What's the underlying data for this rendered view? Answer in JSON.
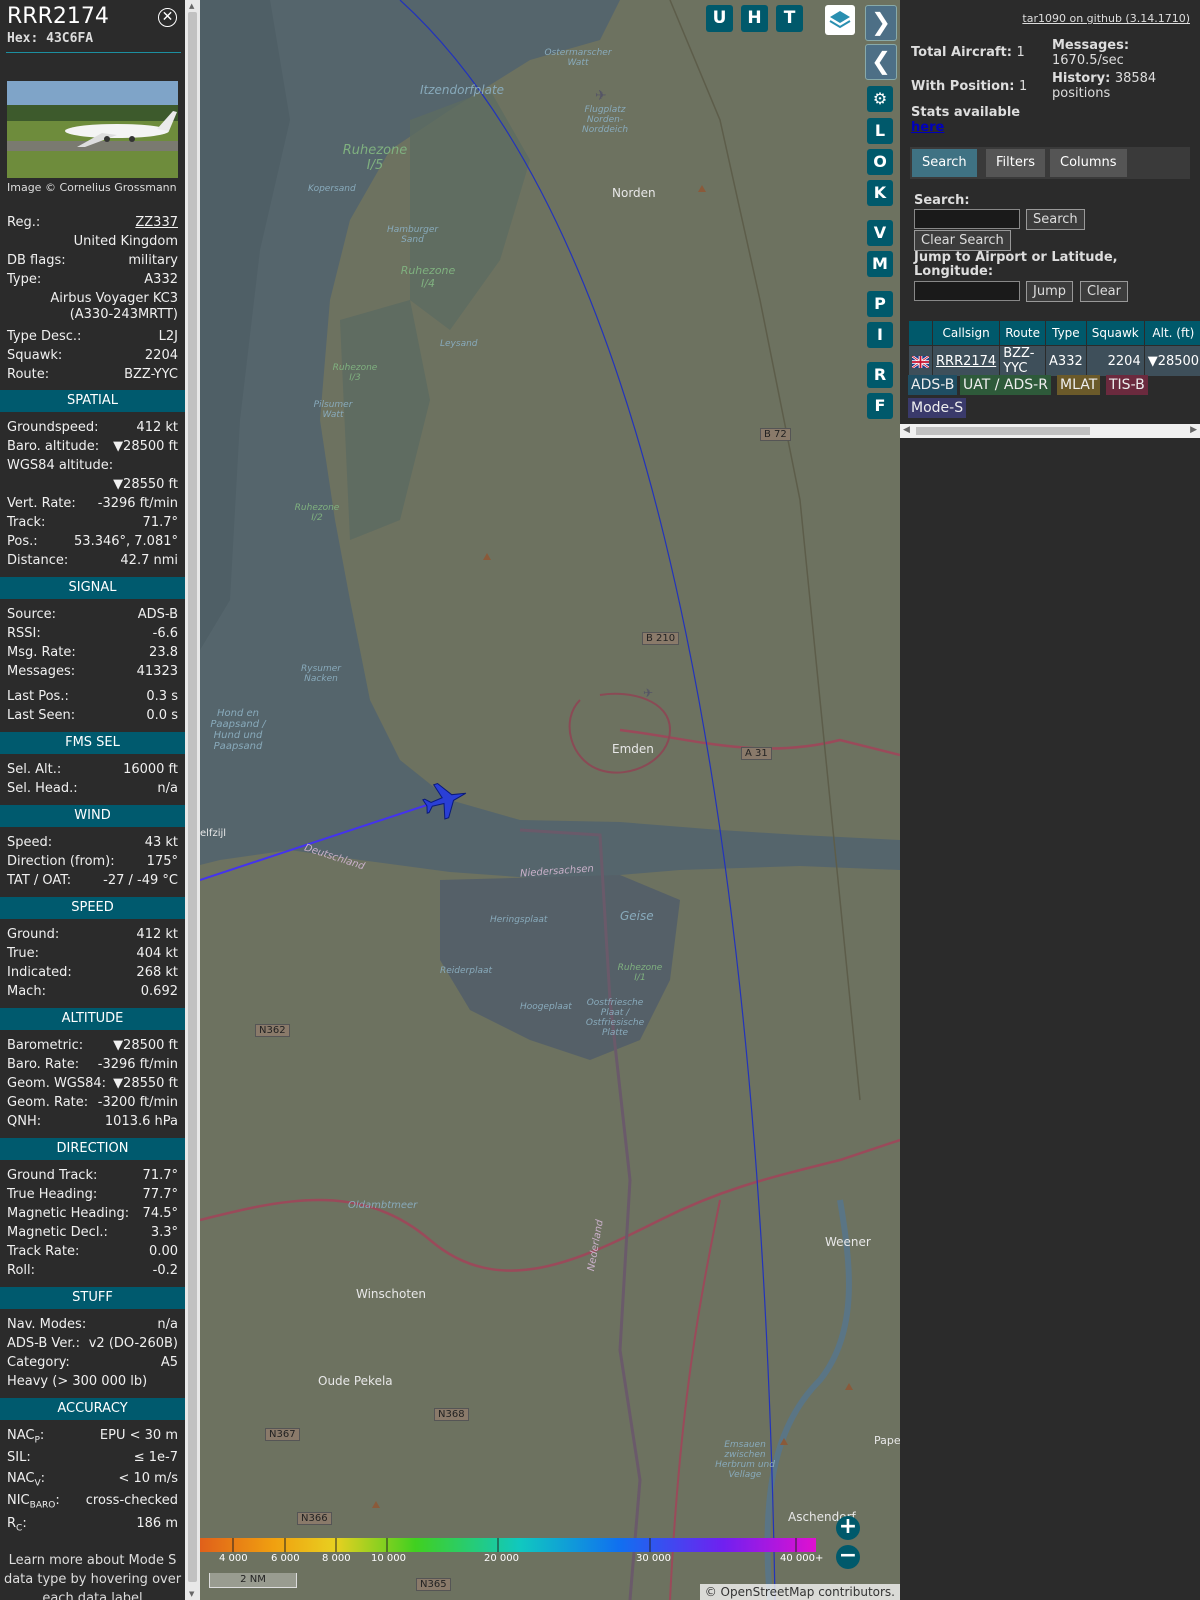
{
  "selected": {
    "callsign": "RRR2174",
    "hex": "Hex: 43C6FA",
    "image_credit": "Image © Cornelius Grossmann",
    "reg_label": "Reg.:",
    "reg_value": "ZZ337",
    "country": "United Kingdom",
    "dbflags_label": "DB flags:",
    "dbflags_value": "military",
    "type_label": "Type:",
    "type_value": "A332",
    "type_full": "Airbus Voyager KC3 (A330-243MRTT)",
    "typedesc_label": "Type Desc.:",
    "typedesc_value": "L2J",
    "squawk_label": "Squawk:",
    "squawk_value": "2204",
    "route_label": "Route:",
    "route_value": "BZZ-YYC"
  },
  "sections": {
    "spatial": "SPATIAL",
    "signal": "SIGNAL",
    "fms": "FMS SEL",
    "wind": "WIND",
    "speed": "SPEED",
    "altitude": "ALTITUDE",
    "direction": "DIRECTION",
    "stuff": "STUFF",
    "accuracy": "ACCURACY"
  },
  "spatial": {
    "gs_label": "Groundspeed:",
    "gs_value": "412 kt",
    "baro_label": "Baro. altitude:",
    "baro_value": "▼28500 ft",
    "wgs_label": "WGS84 altitude:",
    "wgs_value": "▼28550 ft",
    "vrate_label": "Vert. Rate:",
    "vrate_value": "-3296 ft/min",
    "track_label": "Track:",
    "track_value": "71.7°",
    "pos_label": "Pos.:",
    "pos_value": "53.346°, 7.081°",
    "dist_label": "Distance:",
    "dist_value": "42.7 nmi"
  },
  "signal": {
    "source_label": "Source:",
    "source_value": "ADS-B",
    "rssi_label": "RSSI:",
    "rssi_value": "-6.6",
    "msgrate_label": "Msg. Rate:",
    "msgrate_value": "23.8",
    "messages_label": "Messages:",
    "messages_value": "41323",
    "lastpos_label": "Last Pos.:",
    "lastpos_value": "0.3 s",
    "lastseen_label": "Last Seen:",
    "lastseen_value": "0.0 s"
  },
  "fms": {
    "selalt_label": "Sel. Alt.:",
    "selalt_value": "16000 ft",
    "selhead_label": "Sel. Head.:",
    "selhead_value": "n/a"
  },
  "wind": {
    "speed_label": "Speed:",
    "speed_value": "43 kt",
    "dir_label": "Direction (from):",
    "dir_value": "175°",
    "tat_label": "TAT / OAT:",
    "tat_value": "-27 / -49 °C"
  },
  "speed": {
    "ground_label": "Ground:",
    "ground_value": "412 kt",
    "true_label": "True:",
    "true_value": "404 kt",
    "ind_label": "Indicated:",
    "ind_value": "268 kt",
    "mach_label": "Mach:",
    "mach_value": "0.692"
  },
  "altitude": {
    "baro_label": "Barometric:",
    "baro_value": "▼28500 ft",
    "barorate_label": "Baro. Rate:",
    "barorate_value": "-3296 ft/min",
    "geom_label": "Geom. WGS84:",
    "geom_value": "▼28550 ft",
    "geomrate_label": "Geom. Rate:",
    "geomrate_value": "-3200 ft/min",
    "qnh_label": "QNH:",
    "qnh_value": "1013.6 hPa"
  },
  "direction": {
    "gtrack_label": "Ground Track:",
    "gtrack_value": "71.7°",
    "thead_label": "True Heading:",
    "thead_value": "77.7°",
    "mhead_label": "Magnetic Heading:",
    "mhead_value": "74.5°",
    "mdecl_label": "Magnetic Decl.:",
    "mdecl_value": "3.3°",
    "trate_label": "Track Rate:",
    "trate_value": "0.00",
    "roll_label": "Roll:",
    "roll_value": "-0.2"
  },
  "stuff": {
    "nav_label": "Nav. Modes:",
    "nav_value": "n/a",
    "adsb_label": "ADS-B Ver.:",
    "adsb_value": "v2 (DO-260B)",
    "cat_label": "Category:",
    "cat_value": "A5",
    "heavy": "Heavy (> 300 000 lb)"
  },
  "accuracy": {
    "nacp_label": "NAC",
    "nacp_sub": "P",
    "nacp_value": "EPU < 30 m",
    "sil_label": "SIL:",
    "sil_value": "≤ 1e-7",
    "nacv_label": "NAC",
    "nacv_sub": "V",
    "nacv_value": "< 10 m/s",
    "nicbaro_label": "NIC",
    "nicbaro_sub": "BARO",
    "nicbaro_value": "cross-checked",
    "rc_label": "R",
    "rc_sub": "C",
    "rc_value": "186 m"
  },
  "footer_text": "Learn more about Mode S data type by hovering over each data label",
  "map": {
    "top_buttons": [
      "U",
      "H",
      "T"
    ],
    "side_buttons": [
      "L",
      "O",
      "K",
      "V",
      "M",
      "P",
      "I",
      "R",
      "F"
    ],
    "scale_labels": [
      "4 000",
      "6 000",
      "8 000",
      "10 000",
      "20 000",
      "30 000",
      "40 000+"
    ],
    "scale_nm": "2 NM",
    "attribution": "© OpenStreetMap contributors.",
    "places": [
      "Norden",
      "Emden",
      "Weener",
      "Winschoten",
      "Oude Pekela",
      "Aschendorf",
      "Oldambtmeer",
      "elfzijl",
      "Pape"
    ],
    "water_labels": [
      "Ruhezone I/5",
      "Ruhezone I/4",
      "Ruhezone I/3",
      "Ruhezone I/2",
      "Ruhezone I/1",
      "Itzendorfplate",
      "Geise",
      "Ostermarscher Watt",
      "Flugplatz Norden-Norddeich",
      "Kopersand",
      "Hamburger Sand",
      "Leysand",
      "Pilsumer Watt",
      "Rysumer Nacken",
      "Hond en Paapsand / Hund und Paapsand",
      "Heringsplaat",
      "Reiderplaat",
      "Hoogeplaat",
      "Oostfriesche Plaat / Ostfriesische Platte",
      "Emsauen zwischen Herbrum und Vellage"
    ],
    "road_tags": [
      "B 72",
      "B 210",
      "A 31",
      "N362",
      "N368",
      "N367",
      "N366",
      "N365"
    ],
    "border_labels": [
      "Deutschland",
      "Niedersachsen",
      "Nederland"
    ]
  },
  "right": {
    "github": "tar1090 on github (3.14.1710)",
    "total_label": "Total Aircraft:",
    "total_value": "1",
    "withpos_label": "With Position:",
    "withpos_value": "1",
    "stats_label": "Stats available",
    "stats_link": "here",
    "messages_label": "Messages:",
    "messages_value": "1670.5/sec",
    "history_label": "History:",
    "history_value": "38584 positions",
    "tabs": [
      "Search",
      "Filters",
      "Columns"
    ],
    "search_label": "Search:",
    "search_button": "Search",
    "clear_search": "Clear Search",
    "jump_label": "Jump to Airport or Latitude, Longitude:",
    "jump_button": "Jump",
    "clear_button": "Clear",
    "table_headers": [
      "Callsign",
      "Route",
      "Type",
      "Squawk",
      "Alt. (ft)"
    ],
    "table_rows": [
      {
        "callsign": "RRR2174",
        "route": "BZZ-YYC",
        "type": "A332",
        "squawk": "2204",
        "alt": "▼28500"
      }
    ],
    "legend": [
      "ADS-B",
      "UAT / ADS-R",
      "MLAT",
      "TIS-B",
      "Mode-S"
    ],
    "legend_colors": [
      "#1f4e63",
      "#2e5a3a",
      "#6b5a2a",
      "#6b2a3e",
      "#3a3a6b"
    ]
  }
}
